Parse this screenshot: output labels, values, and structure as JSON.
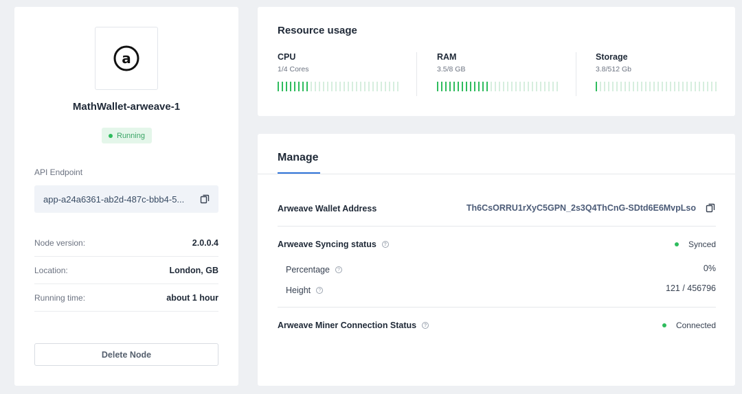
{
  "node": {
    "name": "MathWallet-arweave-1",
    "status": "Running",
    "api_label": "API Endpoint",
    "api_value": "app-a24a6361-ab2d-487c-bbb4-5...",
    "info": [
      {
        "label": "Node version:",
        "value": "2.0.0.4"
      },
      {
        "label": "Location:",
        "value": "London, GB"
      },
      {
        "label": "Running time:",
        "value": "about 1 hour"
      }
    ],
    "delete_label": "Delete Node",
    "logo_icon": "arweave-logo-icon"
  },
  "resource": {
    "title": "Resource usage",
    "items": [
      {
        "name": "CPU",
        "sub": "1/4 Cores",
        "fraction": 0.25
      },
      {
        "name": "RAM",
        "sub": "3.5/8 GB",
        "fraction": 0.4375
      },
      {
        "name": "Storage",
        "sub": "3.8/512 Gb",
        "fraction": 0.0074
      }
    ]
  },
  "manage": {
    "tab": "Manage",
    "wallet_label": "Arweave Wallet Address",
    "wallet_value": "Th6CsORRU1rXyC5GPN_2s3Q4ThCnG-SDtd6E6MvpLso",
    "sync_label": "Arweave Syncing status",
    "sync_value": "Synced",
    "percentage_label": "Percentage",
    "percentage_value": "0%",
    "height_label": "Height",
    "height_value": "121 / 456796",
    "miner_label": "Arweave Miner Connection Status",
    "miner_value": "Connected"
  },
  "colors": {
    "accent": "#2f73d8",
    "success": "#2ebc5d",
    "bar_off": "#d6eede"
  }
}
